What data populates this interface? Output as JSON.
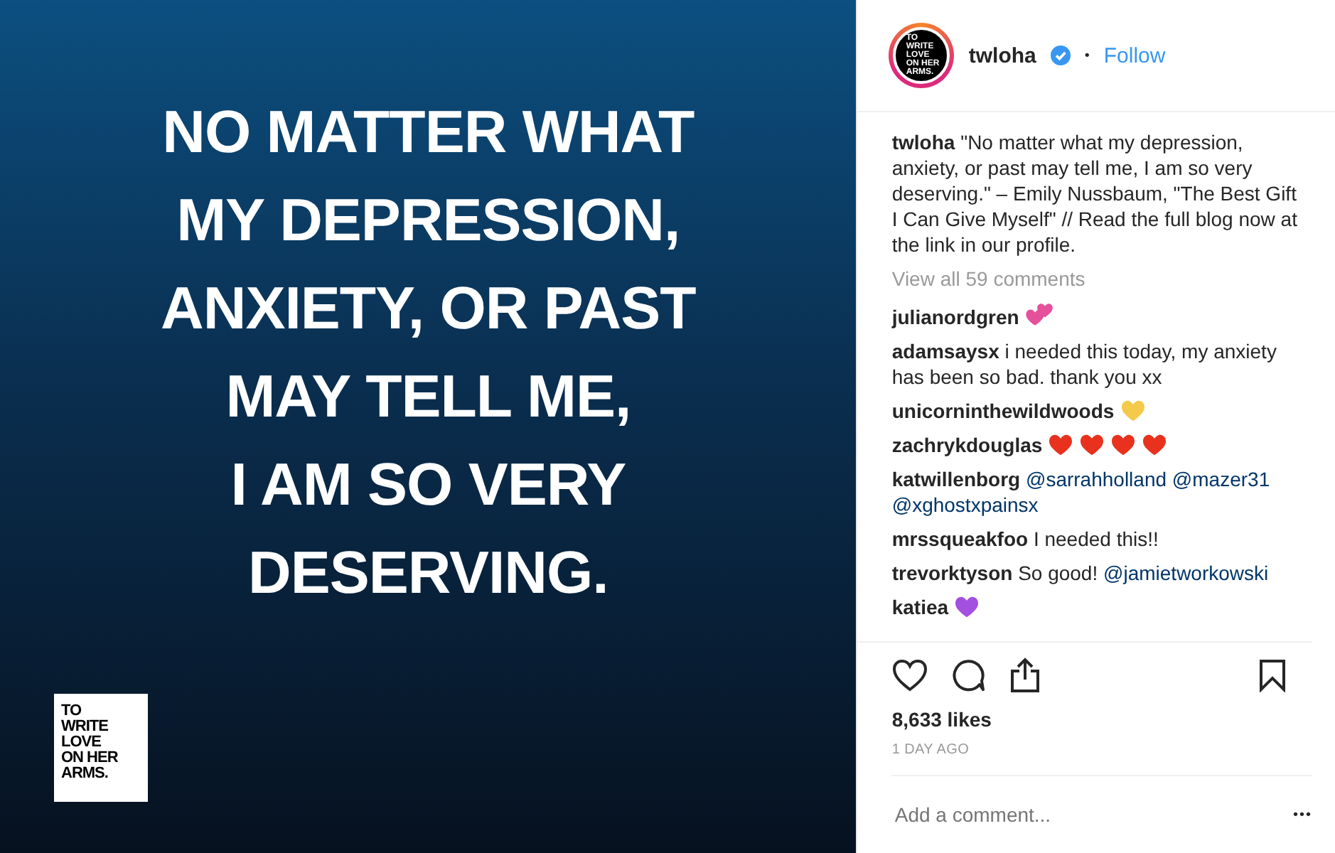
{
  "post_image": {
    "quote_lines": [
      "NO MATTER WHAT",
      "MY DEPRESSION,",
      "ANXIETY, OR PAST",
      "MAY TELL ME,",
      "I AM SO VERY",
      "DESERVING."
    ],
    "logo_lines": [
      "TO",
      "WRITE",
      "LOVE",
      "ON HER",
      "ARMS."
    ]
  },
  "header": {
    "avatar_lines": [
      "TO",
      "WRITE",
      "LOVE",
      "ON HER",
      "ARMS."
    ],
    "username": "twloha",
    "verified": true,
    "separator": "•",
    "follow": "Follow"
  },
  "caption": {
    "user": "twloha",
    "text": "\"No matter what my depression, anxiety, or past may tell me, I am so very deserving.\" – Emily Nussbaum, \"The Best Gift I Can Give Myself\" // Read the full blog now at the link in our profile."
  },
  "view_all": "View all 59 comments",
  "comments": [
    {
      "user": "julianordgren",
      "hearts": [
        {
          "kind": "double",
          "color": "#e5509a"
        }
      ]
    },
    {
      "user": "adamsaysx",
      "parts": [
        {
          "kind": "plain",
          "text": "i needed this today, my anxiety has been so bad. thank you xx"
        }
      ]
    },
    {
      "user": "unicorninthewildwoods",
      "hearts": [
        {
          "kind": "single",
          "color": "#f5c94a"
        }
      ]
    },
    {
      "user": "zachrykdouglas",
      "hearts": [
        {
          "kind": "single",
          "color": "#e8321e"
        },
        {
          "kind": "single",
          "color": "#e8321e"
        },
        {
          "kind": "single",
          "color": "#e8321e"
        },
        {
          "kind": "single",
          "color": "#e8321e"
        }
      ]
    },
    {
      "user": "katwillenborg",
      "parts": [
        {
          "kind": "mention",
          "text": "@sarrahholland"
        },
        {
          "kind": "mention",
          "text": "@mazer31"
        },
        {
          "kind": "mention",
          "text": "@xghostxpainsx"
        }
      ]
    },
    {
      "user": "mrssqueakfoo",
      "parts": [
        {
          "kind": "plain",
          "text": "I needed this!!"
        }
      ]
    },
    {
      "user": "trevorktyson",
      "parts": [
        {
          "kind": "plain",
          "text": "So good!"
        },
        {
          "kind": "mention",
          "text": "@jamietworkowski"
        }
      ]
    },
    {
      "user": "katiea",
      "hearts": [
        {
          "kind": "single",
          "color": "#a34fe0"
        }
      ]
    }
  ],
  "likes": "8,633 likes",
  "time": "1 DAY AGO",
  "comment_field": {
    "placeholder": "Add a comment..."
  },
  "more": "•••"
}
